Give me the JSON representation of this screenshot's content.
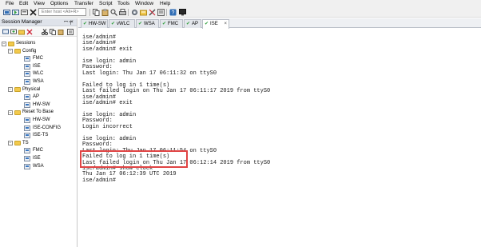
{
  "menu": [
    "File",
    "Edit",
    "View",
    "Options",
    "Transfer",
    "Script",
    "Tools",
    "Window",
    "Help"
  ],
  "toolbar": {
    "host_placeholder": "Enter host <Alt+R>",
    "icons": [
      "connect-icon",
      "quick-connect-icon",
      "new-tab-icon",
      "disconnect-icon",
      "copy-icon",
      "paste-icon",
      "find-icon",
      "print-icon",
      "settings-icon",
      "sftp-icon",
      "keymap-icon",
      "help-icon",
      "monitor-icon"
    ]
  },
  "session_manager": {
    "title": "Session Manager",
    "pin": "ꟷ ╕",
    "close": "×",
    "tree": [
      {
        "label": "Sessions",
        "type": "folder",
        "expander": "−"
      },
      {
        "label": "Config",
        "type": "folder",
        "expander": "−"
      },
      {
        "label": "FMC",
        "type": "session"
      },
      {
        "label": "ISE",
        "type": "session"
      },
      {
        "label": "WLC",
        "type": "session"
      },
      {
        "label": "WSA",
        "type": "session"
      },
      {
        "label": "Physical",
        "type": "folder",
        "expander": "−"
      },
      {
        "label": "AP",
        "type": "session"
      },
      {
        "label": "HW-SW",
        "type": "session"
      },
      {
        "label": "Reset To Base",
        "type": "folder",
        "expander": "−"
      },
      {
        "label": "HW-SW",
        "type": "session"
      },
      {
        "label": "ISE-CONFIG",
        "type": "session"
      },
      {
        "label": "ISE-TS",
        "type": "session"
      },
      {
        "label": "TS",
        "type": "folder",
        "expander": "−"
      },
      {
        "label": "FMC",
        "type": "session"
      },
      {
        "label": "ISE",
        "type": "session"
      },
      {
        "label": "WSA",
        "type": "session"
      }
    ]
  },
  "tabs": [
    {
      "label": "HW-SW",
      "active": false
    },
    {
      "label": "vWLC",
      "active": false
    },
    {
      "label": "WSA",
      "active": false
    },
    {
      "label": "FMC",
      "active": false
    },
    {
      "label": "AP",
      "active": false
    },
    {
      "label": "ISE",
      "active": true,
      "close": "×"
    }
  ],
  "terminal": {
    "lines": [
      "ise/admin#",
      "ise/admin#",
      "ise/admin# exit",
      "",
      "ise login: admin",
      "Password:",
      "Last login: Thu Jan 17 06:11:32 on ttyS0",
      "",
      "Failed to log in 1 time(s)",
      "Last failed login on Thu Jan 17 06:11:17 2019 from ttyS0",
      "ise/admin#",
      "ise/admin# exit",
      "",
      "ise login: admin",
      "Password:",
      "Login incorrect",
      "",
      "ise login: admin",
      "Password:",
      "Last login: Thu Jan 17 06:11:54 on ttyS0",
      "Failed to log in 1 time(s)",
      "Last failed login on Thu Jan 17 06:12:14 2019 from ttyS0",
      "ise/admin# show clock",
      "Thu Jan 17 06:12:39 UTC 2019",
      "ise/admin#"
    ],
    "highlight_color": "#e04444"
  }
}
